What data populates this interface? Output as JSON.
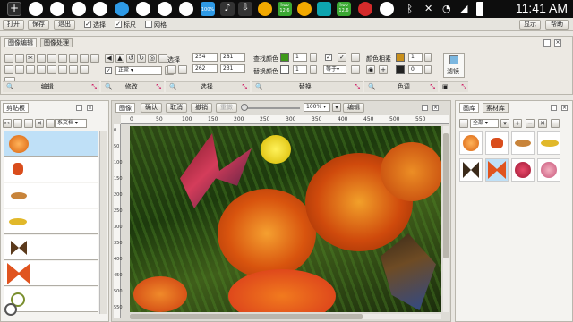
{
  "statusbar": {
    "time": "11:41 AM",
    "badge1": "100%",
    "badge2": "hoo\n12.6",
    "badge3": "hoo\n12.6"
  },
  "cmdbar": {
    "open": "打开",
    "save": "保存",
    "exit": "退出",
    "select": "选择",
    "ruler": "标尺",
    "grid": "网格",
    "show": "显示",
    "help": "帮助"
  },
  "ribbon": {
    "tabs": [
      "图像编辑",
      "图像处理"
    ],
    "groups": [
      "编辑",
      "修改",
      "选择",
      "替换",
      "色调"
    ],
    "mode": "正常",
    "sel_label": "选择",
    "sel_x": "254",
    "sel_y": "281",
    "sel_w": "262",
    "sel_h": "231",
    "find_color": "查找颜色",
    "replace_color": "替换颜色",
    "find_val": "1",
    "replace_val": "1",
    "cmp": "等于",
    "color_similar": "颜色相素",
    "tone_val1": "1",
    "tone_val2": "0",
    "filter": "滤镜",
    "filter_group": ""
  },
  "left_panel": {
    "title": "剪贴板",
    "type": "系文档"
  },
  "canvas_bar": {
    "tabs": [
      "图像",
      "确认",
      "取消",
      "撤销",
      "重做"
    ],
    "zoom": "100%",
    "edit": "编辑"
  },
  "ruler_top": [
    "0",
    "50",
    "100",
    "150",
    "200",
    "250",
    "300",
    "350",
    "400",
    "450",
    "500",
    "550"
  ],
  "ruler_left": [
    "0",
    "50",
    "100",
    "150",
    "200",
    "250",
    "300",
    "350",
    "400",
    "450",
    "500",
    "550"
  ],
  "right_panel": {
    "tabs": [
      "画库",
      "素材库"
    ],
    "filter": "全部"
  },
  "colors": {
    "accent": "#3aa0e8",
    "find_swatch": "#3e9a1a",
    "tone_swatch": "#c9901c"
  }
}
